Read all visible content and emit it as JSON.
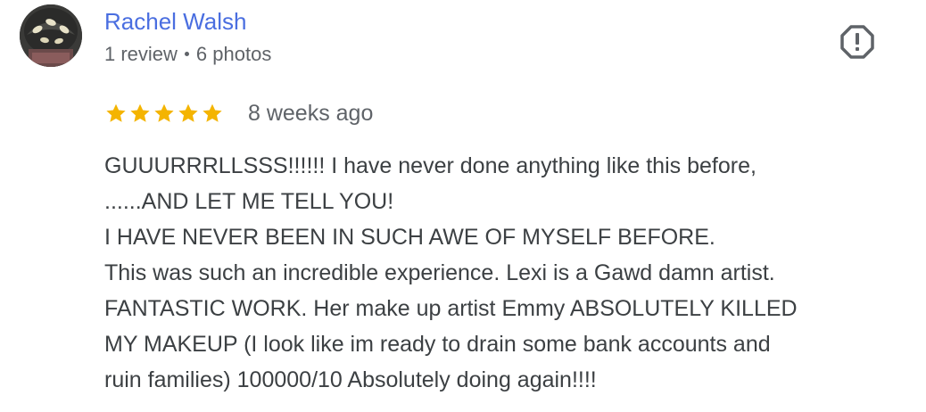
{
  "author": {
    "name": "Rachel Walsh",
    "review_count": "1 review",
    "photo_count": "6 photos"
  },
  "review": {
    "rating": 5,
    "rating_max": 5,
    "date": "8 weeks ago",
    "lines": [
      "GUUURRRLLSSS!!!!!! I have never done anything like this before,",
      "......AND LET ME TELL YOU!",
      "I HAVE NEVER BEEN IN SUCH AWE OF MYSELF BEFORE.",
      "This was such an incredible experience. Lexi is a Gawd damn artist.",
      "FANTASTIC WORK. Her make up artist Emmy ABSOLUTELY KILLED",
      "MY MAKEUP (I look like im ready to drain some bank accounts and",
      "ruin families) 100000/10 Absolutely doing again!!!!"
    ]
  },
  "icons": {
    "report": "report-octagon-icon",
    "star": "star-icon"
  },
  "colors": {
    "author_name": "#4a6ee0",
    "star": "#f4b400",
    "meta_text": "#5f6368",
    "body_text": "#3c4043",
    "report_icon": "#5f6368"
  }
}
